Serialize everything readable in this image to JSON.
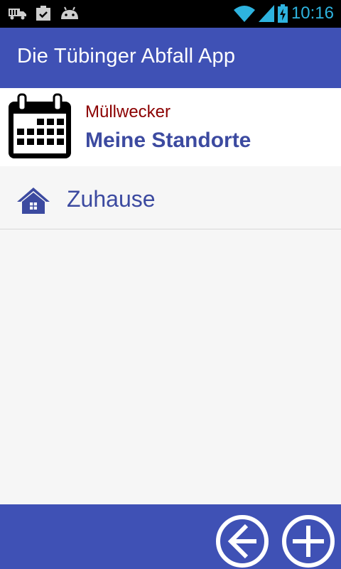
{
  "status_bar": {
    "time": "10:16",
    "icons": [
      "truck-icon",
      "clipboard-check-icon",
      "android-icon",
      "wifi-icon",
      "signal-icon",
      "battery-charging-icon"
    ]
  },
  "app_bar": {
    "title": "Die Tübinger Abfall App"
  },
  "header": {
    "icon": "calendar-icon",
    "subtitle": "Müllwecker",
    "title": "Meine Standorte"
  },
  "locations": [
    {
      "label": "Zuhause",
      "icon": "home-icon"
    }
  ],
  "bottom_bar": {
    "buttons": [
      "back-circle-icon",
      "add-circle-icon"
    ]
  },
  "colors": {
    "primary": "#3f51b5",
    "accent_text": "#3c4aa0",
    "subtitle_red": "#8b0000",
    "clock_blue": "#2eb3df",
    "background": "#f6f6f6"
  }
}
